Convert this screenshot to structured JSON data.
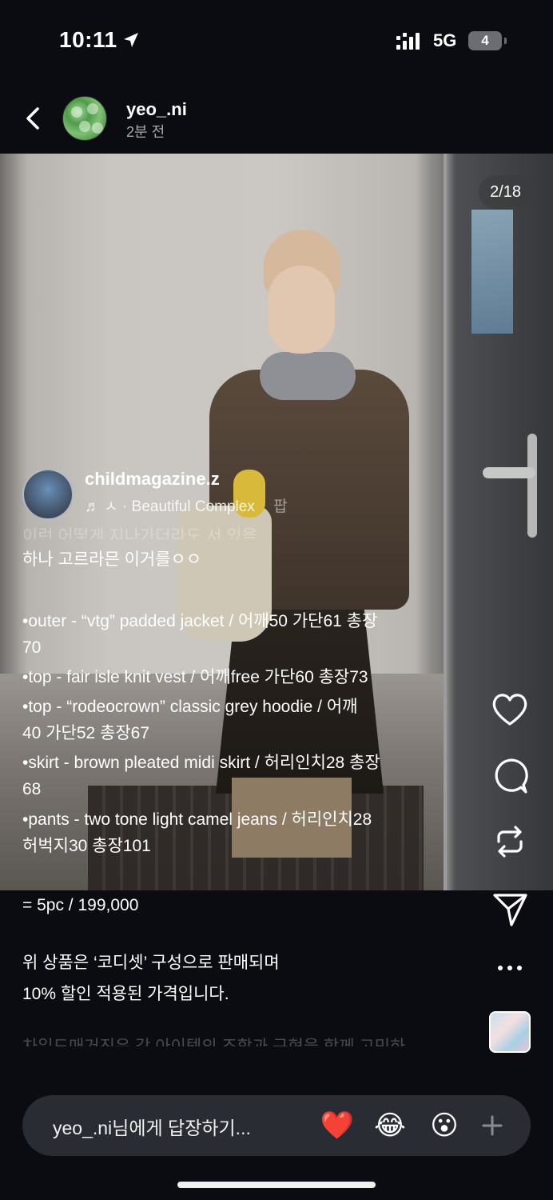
{
  "status_bar": {
    "time": "10:11",
    "network": "5G",
    "battery": "4"
  },
  "header": {
    "username": "yeo_.ni",
    "time_ago": "2분 전"
  },
  "story": {
    "page_counter": "2/18",
    "reel_owner": {
      "name": "childmagazine.z",
      "music_note": "♬",
      "music": "ㅅ · Beautiful Complex",
      "music_tail": "팝"
    },
    "caption_faded_top": "이런 어떻게 지나가더라도 서 있을",
    "caption_intro": "하나 고르라믄 이거를ㅇㅇ",
    "items": [
      "•outer - “vtg” padded jacket / 어깨50 가단61 총장",
      "70",
      "•top - fair isle knit vest / 어깨free 가단60 총장73",
      "•top - “rodeocrown” classic grey hoodie / 어깨",
      "40 가단52 총장67",
      "•skirt - brown pleated midi skirt / 허리인치28 총장",
      "68",
      "•pants - two tone light camel jeans / 허리인치28",
      "허벅지30 총장101"
    ]
  },
  "caption_lower": {
    "total": "= 5pc / 199,000",
    "note_line1": "위 상품은 ‘코디셋’ 구성으로 판매되며",
    "note_line2": "10% 할인 적용된 가격입니다.",
    "faded": "차일드매거진은 각 아이템의 조합과 구현을 함께 고민하"
  },
  "actions": {
    "like": "heart-icon",
    "comment": "comment-icon",
    "repost": "repost-icon",
    "share": "send-icon",
    "more": "more-icon"
  },
  "reply": {
    "placeholder": "yeo_.ni님에게 답장하기...",
    "reactions": [
      "❤️",
      "😂",
      "😮"
    ]
  },
  "colors": {
    "background": "#0b0c12",
    "reply_bar": "#2a2c34",
    "text_muted": "#a8a8a8"
  }
}
